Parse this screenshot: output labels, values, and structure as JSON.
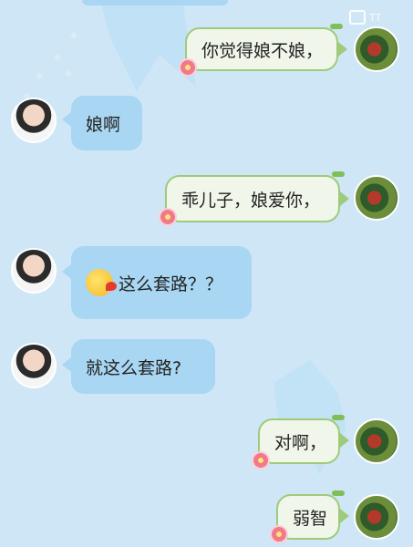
{
  "watermark": {
    "text": "TT"
  },
  "messages": [
    {
      "side": "right",
      "text": "你觉得娘不娘，",
      "avatar": "girl-avatar"
    },
    {
      "side": "left",
      "text": "娘啊",
      "avatar": "boy-avatar"
    },
    {
      "side": "right",
      "text": "乖儿子，娘爱你，",
      "avatar": "girl-avatar"
    },
    {
      "side": "left",
      "text": "这么套路？？",
      "emoji": "sunglasses-kiss-emoji",
      "avatar": "boy-avatar"
    },
    {
      "side": "left",
      "text": "就这么套路?",
      "avatar": "boy-avatar"
    },
    {
      "side": "right",
      "text": "对啊，",
      "avatar": "girl-avatar"
    },
    {
      "side": "right",
      "text": "弱智",
      "avatar": "girl-avatar"
    }
  ]
}
